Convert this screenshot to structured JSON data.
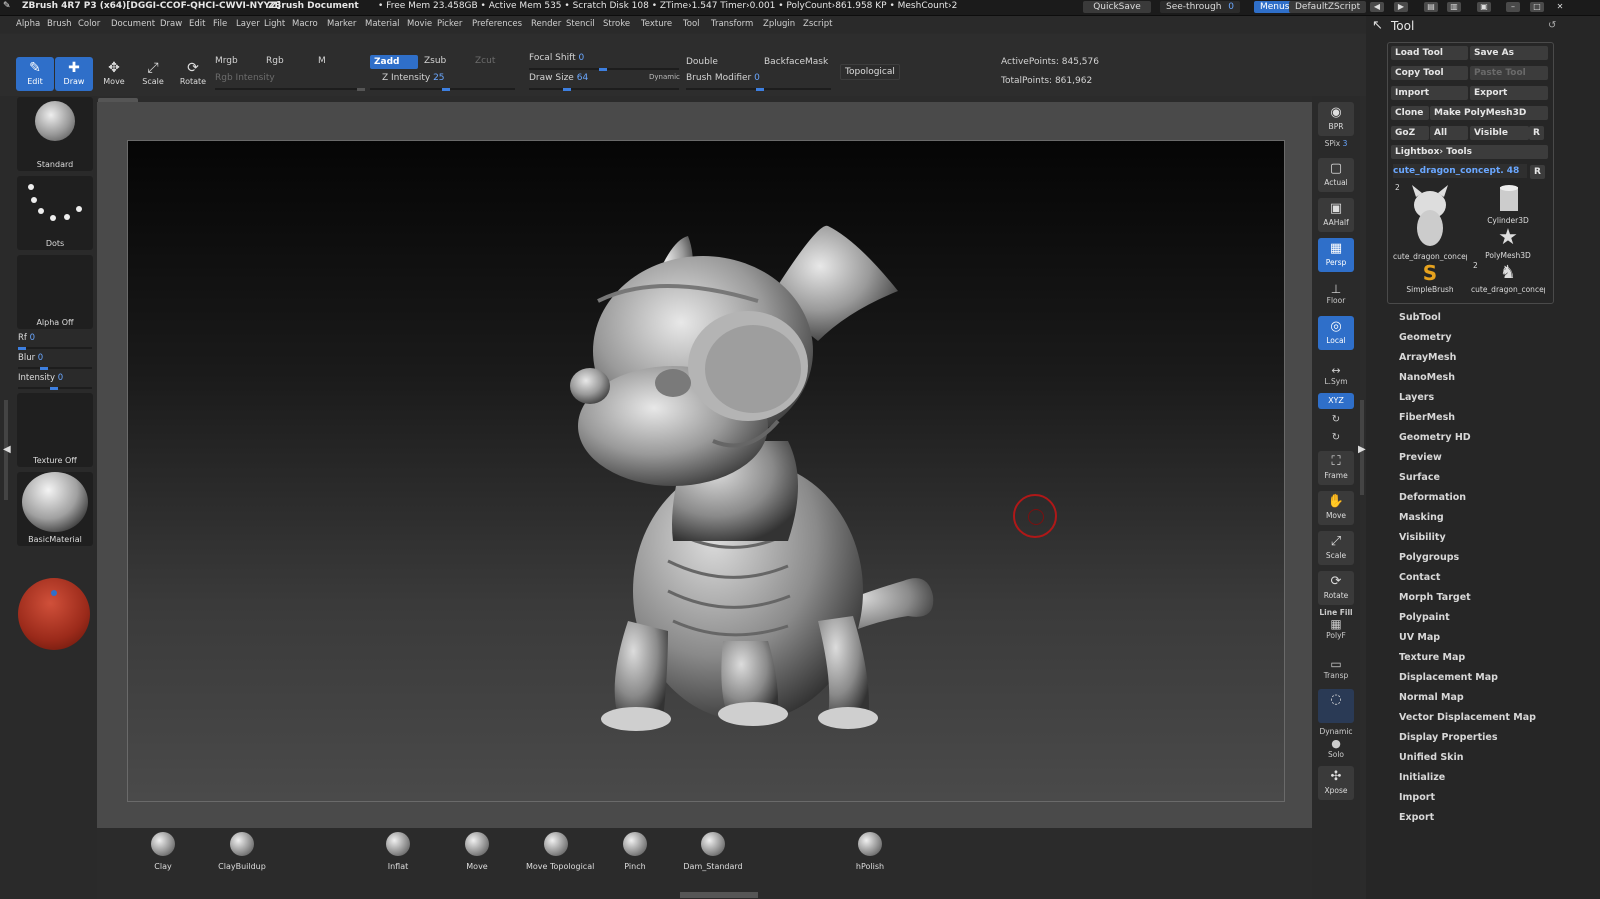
{
  "titlebar": {
    "app": "ZBrush 4R7 P3 (x64)[DGGI-CCOF-QHCI-CWVI-NYYZ]",
    "document": "ZBrush Document",
    "stats": "• Free Mem 23.458GB • Active Mem 535 • Scratch Disk 108 • ZTime›1.547 Timer›0.001 • PolyCount›861.958 KP • MeshCount›2",
    "quicksave": "QuickSave",
    "see_through_label": "See-through",
    "see_through_value": "0",
    "menus": "Menus",
    "default_zscript": "DefaultZScript"
  },
  "menubar": [
    "Alpha",
    "Brush",
    "Color",
    "Document",
    "Draw",
    "Edit",
    "File",
    "Layer",
    "Light",
    "Macro",
    "Marker",
    "Material",
    "Movie",
    "Picker",
    "Preferences",
    "Render",
    "Stencil",
    "Stroke",
    "Texture",
    "Tool",
    "Transform",
    "Zplugin",
    "Zscript"
  ],
  "shelf": {
    "edit": "Edit",
    "draw": "Draw",
    "move": "Move",
    "scale": "Scale",
    "rotate": "Rotate",
    "mrgb": "Mrgb",
    "rgb": "Rgb",
    "m": "M",
    "rgb_intensity": "Rgb Intensity",
    "zadd": "Zadd",
    "zsub": "Zsub",
    "zcut": "Zcut",
    "z_intensity_label": "Z Intensity",
    "z_intensity_value": "25",
    "focal_shift_label": "Focal Shift",
    "focal_shift_value": "0",
    "draw_size_label": "Draw Size",
    "draw_size_value": "64",
    "dynamic": "Dynamic",
    "double": "Double",
    "backfacemask": "BackfaceMask",
    "brush_modifier_label": "Brush Modifier",
    "brush_modifier_value": "0",
    "topological": "Topological",
    "active_points": "ActivePoints: 845,576",
    "total_points": "TotalPoints: 861,962"
  },
  "leftpanel": {
    "brush": "Standard",
    "stroke": "Dots",
    "alpha": "Alpha Off",
    "rf_label": "Rf",
    "rf_value": "0",
    "blur_label": "Blur",
    "blur_value": "0",
    "intensity_label": "Intensity",
    "intensity_value": "0",
    "texture": "Texture Off",
    "material": "BasicMaterial"
  },
  "bottom_brushes": [
    "Clay",
    "ClayBuildup",
    "Inflat",
    "Move",
    "Move Topological",
    "Pinch",
    "Dam_Standard",
    "hPolish"
  ],
  "rightbar": {
    "bpr": "BPR",
    "spix_label": "SPix",
    "spix_value": "3",
    "actual": "Actual",
    "aahalf": "AAHalf",
    "persp": "Persp",
    "floor": "Floor",
    "local": "Local",
    "lsym": "L.Sym",
    "xyz": "XYZ",
    "frame": "Frame",
    "move": "Move",
    "scale": "Scale",
    "rotate": "Rotate",
    "line_fill": "Line Fill",
    "polyf": "PolyF",
    "transp": "Transp",
    "dynamic": "Dynamic",
    "solo": "Solo",
    "xpose": "Xpose"
  },
  "toolpanel": {
    "title": "Tool",
    "load_tool": "Load Tool",
    "save_as": "Save As",
    "copy_tool": "Copy Tool",
    "paste_tool": "Paste Tool",
    "import": "Import",
    "export": "Export",
    "clone": "Clone",
    "make_polymesh": "Make PolyMesh3D",
    "goz": "GoZ",
    "all": "All",
    "visible": "Visible",
    "r": "R",
    "lightbox_tools": "Lightbox› Tools",
    "current_tool": "cute_dragon_concept. 48",
    "thumbs": [
      {
        "num": "2",
        "label": "cute_dragon_concep"
      },
      {
        "num": "",
        "label": "Cylinder3D"
      },
      {
        "num": "",
        "label": "PolyMesh3D"
      },
      {
        "num": "",
        "label": "SimpleBrush"
      },
      {
        "num": "2",
        "label": "cute_dragon_concep"
      }
    ],
    "sections": [
      "SubTool",
      "Geometry",
      "ArrayMesh",
      "NanoMesh",
      "Layers",
      "FiberMesh",
      "Geometry HD",
      "Preview",
      "Surface",
      "Deformation",
      "Masking",
      "Visibility",
      "Polygroups",
      "Contact",
      "Morph Target",
      "Polypaint",
      "UV Map",
      "Texture Map",
      "Displacement Map",
      "Normal Map",
      "Vector Displacement Map",
      "Display Properties",
      "Unified Skin",
      "Initialize",
      "Import",
      "Export"
    ]
  },
  "colors": {
    "accent": "#2f6fc9",
    "value_text": "#6aa7ff",
    "cursor_ring": "#b01818"
  }
}
